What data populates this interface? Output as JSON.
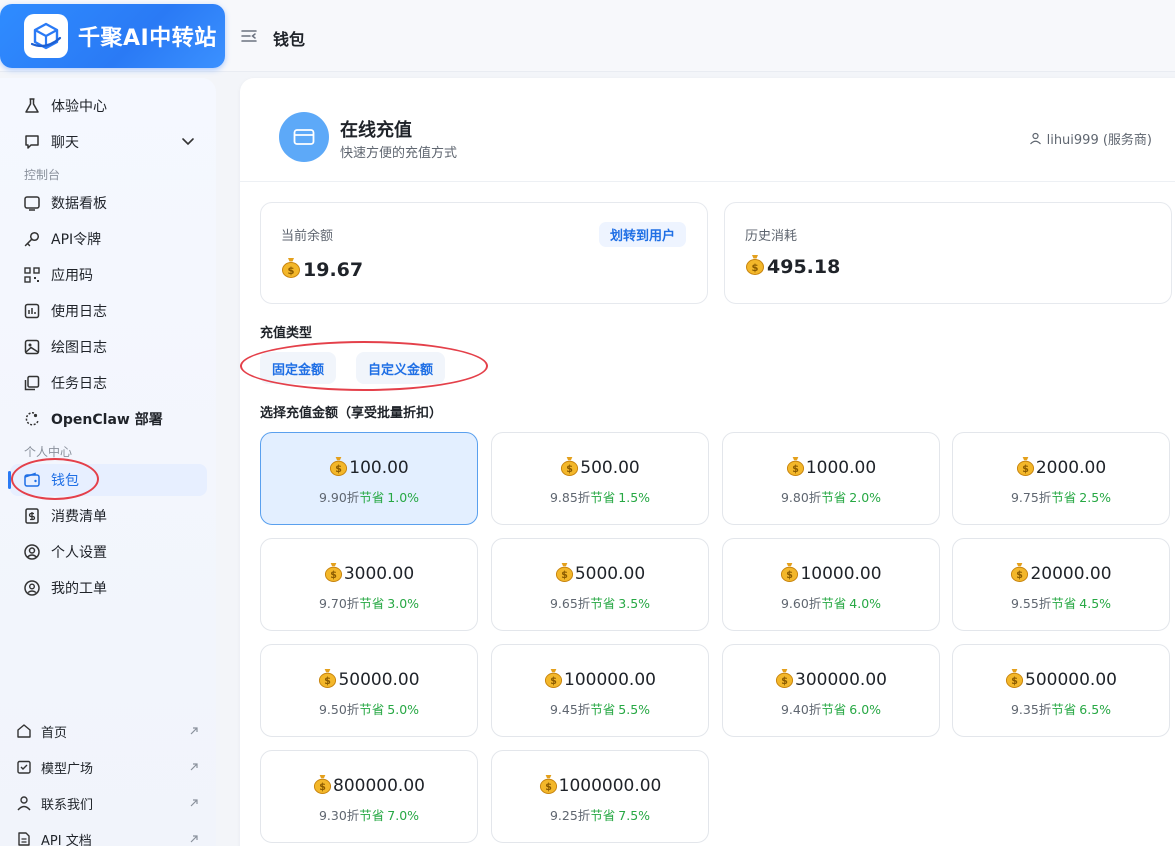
{
  "app": {
    "name": "千聚AI中转站",
    "page_title": "钱包"
  },
  "sidebar": {
    "top_items": [
      {
        "label": "体验中心",
        "icon": "flask-icon"
      },
      {
        "label": "聊天",
        "icon": "chat-icon"
      }
    ],
    "console_label": "控制台",
    "console_items": [
      {
        "label": "数据看板",
        "icon": "dashboard-icon"
      },
      {
        "label": "API令牌",
        "icon": "key-icon"
      },
      {
        "label": "应用码",
        "icon": "qrcode-icon"
      },
      {
        "label": "使用日志",
        "icon": "log-icon"
      },
      {
        "label": "绘图日志",
        "icon": "image-icon"
      },
      {
        "label": "任务日志",
        "icon": "task-icon"
      },
      {
        "label": "OpenClaw 部署",
        "icon": "claw-icon"
      }
    ],
    "personal_label": "个人中心",
    "personal_items": [
      {
        "label": "钱包",
        "icon": "wallet-icon",
        "active": true
      },
      {
        "label": "消费清单",
        "icon": "bill-icon"
      },
      {
        "label": "个人设置",
        "icon": "user-settings-icon"
      },
      {
        "label": "我的工单",
        "icon": "ticket-icon"
      }
    ],
    "bottom_items": [
      {
        "label": "首页",
        "icon": "home-icon"
      },
      {
        "label": "模型广场",
        "icon": "model-icon"
      },
      {
        "label": "联系我们",
        "icon": "contact-icon"
      },
      {
        "label": "API 文档",
        "icon": "doc-icon"
      }
    ]
  },
  "recharge": {
    "title": "在线充值",
    "subtitle": "快速方便的充值方式",
    "user": "lihui999 (服务商)",
    "balance_label": "当前余额",
    "balance_value": "19.67",
    "transfer_label": "划转到用户",
    "history_label": "历史消耗",
    "history_value": "495.18",
    "type_title": "充值类型",
    "types": [
      "固定金额",
      "自定义金额"
    ],
    "amount_title": "选择充值金额（享受批量折扣）",
    "amounts": [
      {
        "value": "100.00",
        "discount": "9.90折",
        "save_label": "节省",
        "save": "1.0%"
      },
      {
        "value": "500.00",
        "discount": "9.85折",
        "save_label": "节省",
        "save": "1.5%"
      },
      {
        "value": "1000.00",
        "discount": "9.80折",
        "save_label": "节省",
        "save": "2.0%"
      },
      {
        "value": "2000.00",
        "discount": "9.75折",
        "save_label": "节省",
        "save": "2.5%"
      },
      {
        "value": "3000.00",
        "discount": "9.70折",
        "save_label": "节省",
        "save": "3.0%"
      },
      {
        "value": "5000.00",
        "discount": "9.65折",
        "save_label": "节省",
        "save": "3.5%"
      },
      {
        "value": "10000.00",
        "discount": "9.60折",
        "save_label": "节省",
        "save": "4.0%"
      },
      {
        "value": "20000.00",
        "discount": "9.55折",
        "save_label": "节省",
        "save": "4.5%"
      },
      {
        "value": "50000.00",
        "discount": "9.50折",
        "save_label": "节省",
        "save": "5.0%"
      },
      {
        "value": "100000.00",
        "discount": "9.45折",
        "save_label": "节省",
        "save": "5.5%"
      },
      {
        "value": "300000.00",
        "discount": "9.40折",
        "save_label": "节省",
        "save": "6.0%"
      },
      {
        "value": "500000.00",
        "discount": "9.35折",
        "save_label": "节省",
        "save": "6.5%"
      },
      {
        "value": "800000.00",
        "discount": "9.30折",
        "save_label": "节省",
        "save": "7.0%"
      },
      {
        "value": "1000000.00",
        "discount": "9.25折",
        "save_label": "节省",
        "save": "7.5%"
      }
    ]
  },
  "colors": {
    "accent": "#2a7af5",
    "save_green": "#27a844",
    "annotation_red": "#e4404a"
  }
}
